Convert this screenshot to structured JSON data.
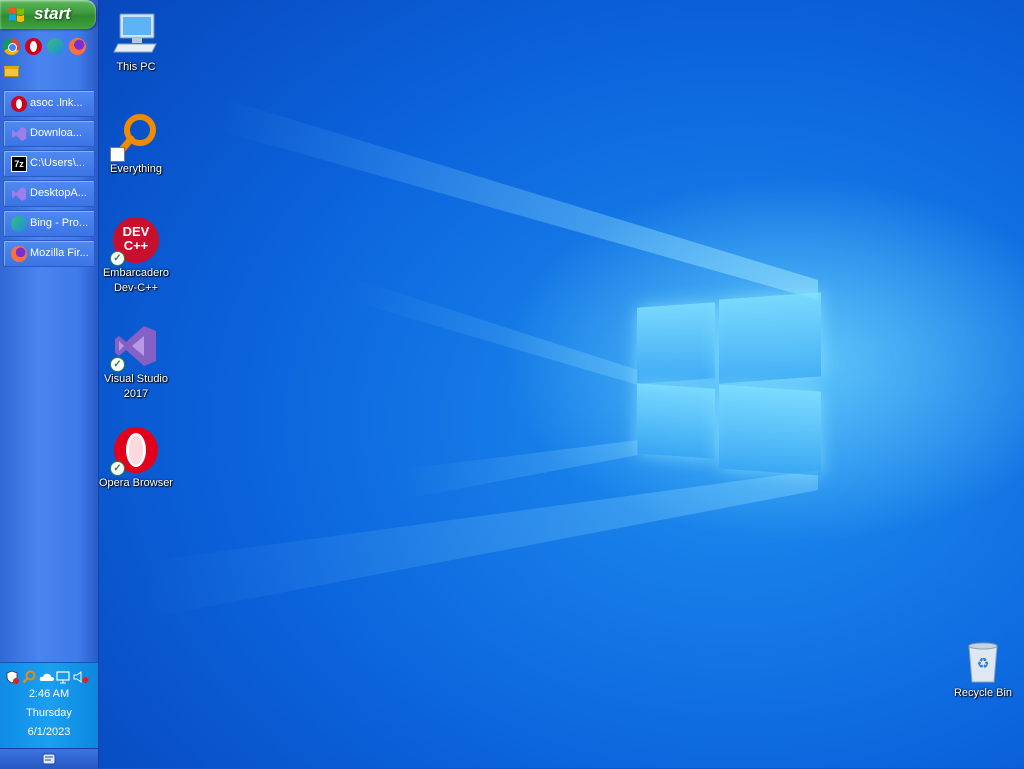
{
  "taskbar": {
    "start_label": "start",
    "quick_launch": [
      {
        "icon": "chrome-icon",
        "color": "#e53935"
      },
      {
        "icon": "opera-icon",
        "color": "#d0021b"
      },
      {
        "icon": "edge-icon",
        "color": "#1e88e5"
      },
      {
        "icon": "firefox-icon",
        "color": "#ff7139"
      },
      {
        "icon": "file-explorer-icon",
        "color": "#f4c542"
      }
    ],
    "tasks": [
      {
        "label": "asoc .lnk...",
        "icon": "opera-icon"
      },
      {
        "label": "Downloa...",
        "icon": "visual-studio-icon"
      },
      {
        "label": "C:\\Users\\...",
        "icon": "7zip-icon"
      },
      {
        "label": "DesktopA...",
        "icon": "visual-studio-icon"
      },
      {
        "label": "Bing - Pro...",
        "icon": "edge-icon"
      },
      {
        "label": "Mozilla Fir...",
        "icon": "firefox-icon"
      }
    ]
  },
  "tray": {
    "icons": [
      "security-icon",
      "search-icon",
      "onedrive-icon",
      "network-icon",
      "volume-muted-icon"
    ],
    "time": "2:46 AM",
    "day": "Thursday",
    "date": "6/1/2023"
  },
  "desktop": {
    "icons": [
      {
        "label": "This PC"
      },
      {
        "label": "Everything"
      },
      {
        "label": "Embarcadero Dev-C++"
      },
      {
        "label": "Visual Studio 2017"
      },
      {
        "label": "Opera Browser"
      },
      {
        "label": "Recycle Bin"
      }
    ],
    "devcpp_icon_text": "DEV C++"
  },
  "colors": {
    "taskbar": "#3f7bea",
    "start": "#3c9a3c",
    "tray": "#1ba0f0",
    "wallpaper": "#0b63dc"
  }
}
